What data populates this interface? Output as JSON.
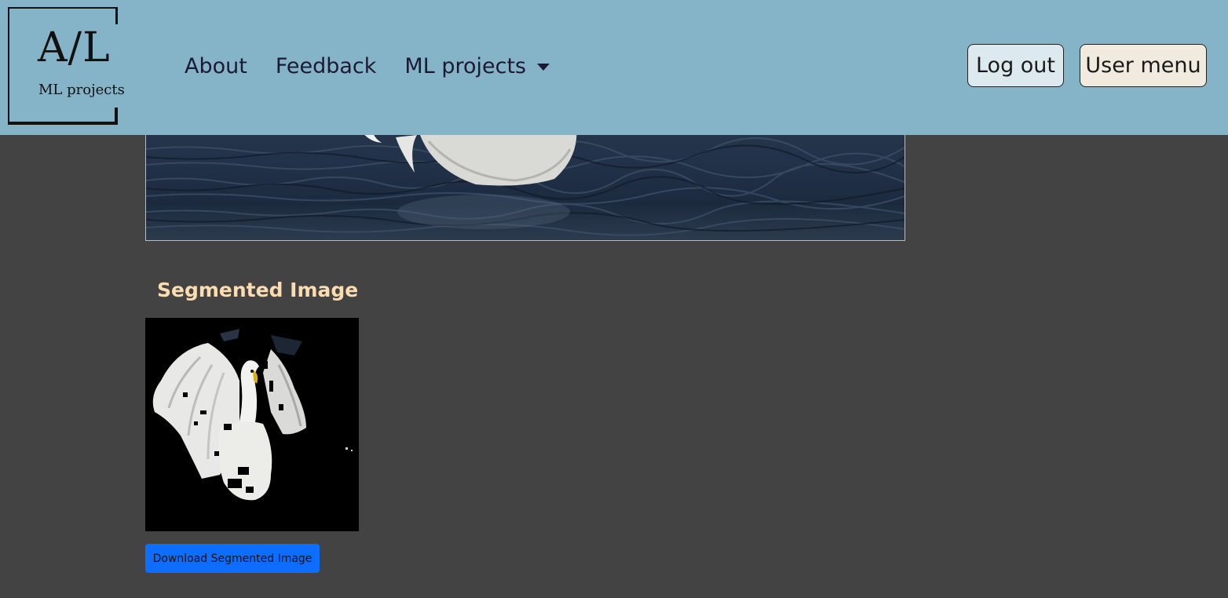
{
  "brand": {
    "logo_main": "A/L",
    "logo_sub": "ML projects"
  },
  "nav": {
    "links": [
      "About",
      "Feedback"
    ],
    "dropdown_label": "ML projects",
    "logout_label": "Log out",
    "usermenu_label": "User menu"
  },
  "main": {
    "segmented_title": "Segmented Image",
    "download_label": "Download Segmented Image"
  },
  "colors": {
    "navbar": "#85b4c9",
    "background": "#434343",
    "title": "#fbdcb0",
    "download_button": "#0d6efd"
  }
}
